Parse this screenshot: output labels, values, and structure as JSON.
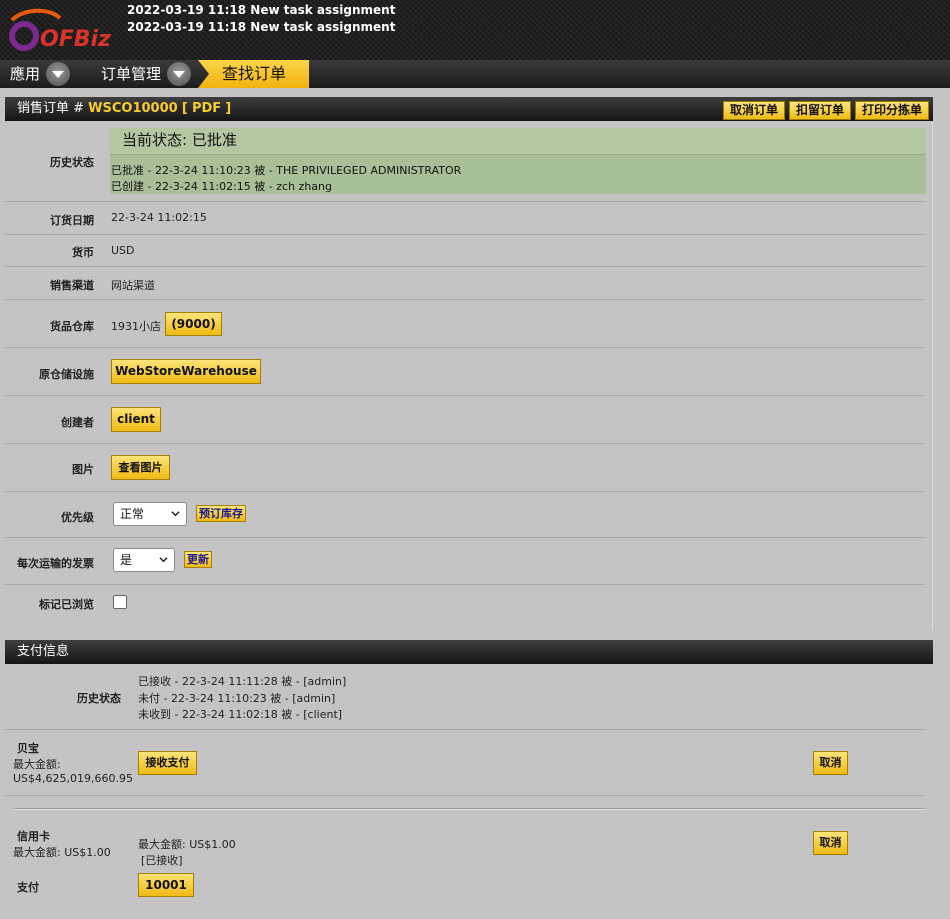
{
  "header": {
    "logo_text": "OFBiz",
    "notices": [
      "2022-03-19 11:18 New task assignment",
      "2022-03-19 11:18 New task assignment"
    ]
  },
  "nav": {
    "apps_label": "應用",
    "order_mgmt_label": "订单管理",
    "find_order_label": "查找订单"
  },
  "order": {
    "title_prefix": "销售订单 #",
    "order_id": "WSCO10000",
    "open_bracket": "[",
    "pdf_label": "PDF",
    "close_bracket": "]",
    "actions": [
      "取消订单",
      "扣留订单",
      "打印分拣单"
    ],
    "history_label": "历史状态",
    "current_status": "当前状态: 已批准",
    "history": [
      "已批准 - 22-3-24 11:10:23   被 - THE PRIVILEGED ADMINISTRATOR",
      "已创建 - 22-3-24 11:02:15   被 - zch zhang"
    ],
    "order_date_label": "订货日期",
    "order_date": "22-3-24 11:02:15",
    "currency_label": "货币",
    "currency": "USD",
    "channel_label": "销售渠道",
    "channel": "网站渠道",
    "store_label": "货品仓库",
    "store": "1931小店",
    "store_button": "(9000)",
    "facility_label": "原仓储设施",
    "facility_button": "WebStoreWarehouse",
    "creator_label": "创建者",
    "creator_button": "client",
    "image_label": "图片",
    "image_button": "查看图片",
    "priority_label": "优先级",
    "priority_value": "正常",
    "reserve_button": "预订库存",
    "invoice_label": "每次运输的发票",
    "invoice_value": "是",
    "update_button": "更新",
    "viewed_label": "标记已浏览"
  },
  "payment": {
    "title": "支付信息",
    "history_label": "历史状态",
    "history": [
      "已接收 - 22-3-24 11:11:28   被 - [admin]",
      "未付 - 22-3-24 11:10:23   被 - [admin]",
      "未收到 - 22-3-24 11:02:18   被 - [client]"
    ],
    "paypal": {
      "name": "贝宝",
      "max_label": "最大金额:",
      "max_amount": "US$4,625,019,660.95",
      "receive_button": "接收支付",
      "cancel_button": "取消"
    },
    "credit": {
      "name": "信用卡",
      "max_line": "最大金额: US$1.00",
      "max_detail": "最大金额: US$1.00",
      "received": "[已接收]",
      "cancel_button": "取消",
      "payment_label": "支付",
      "payment_button": "10001"
    }
  },
  "colors": {
    "accent": "#f6cd2b",
    "status_green": "#b3c8a1",
    "header_dark": "#1f1f1f"
  }
}
